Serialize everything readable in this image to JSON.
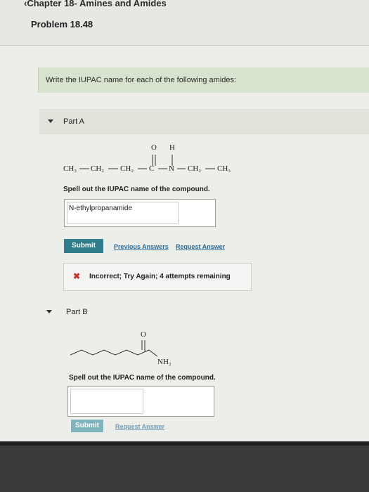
{
  "header": {
    "back_link": "Chapter 18- Amines and Amides",
    "problem_title": "Problem 18.48"
  },
  "instruction": "Write the IUPAC name for each of the following amides:",
  "part_a": {
    "label": "Part A",
    "structure": {
      "ch3_left": "CH₃",
      "ch2_1": "CH₂",
      "ch2_2": "CH₂",
      "c": "C",
      "n": "N",
      "ch2_3": "CH₂",
      "ch3_right": "CH₃",
      "o": "O",
      "h": "H"
    },
    "prompt": "Spell out the IUPAC name of the compound.",
    "answer_value": "N-ethylpropanamide",
    "submit_label": "Submit",
    "previous_answers_label": "Previous Answers",
    "request_answer_label": "Request Answer",
    "feedback": "Incorrect; Try Again; 4 attempts remaining"
  },
  "part_b": {
    "label": "Part B",
    "structure": {
      "o": "O",
      "nh2": "NH₂"
    },
    "prompt": "Spell out the IUPAC name of the compound.",
    "answer_value": "",
    "submit_label": "Submit",
    "request_answer_label": "Request Answer"
  },
  "colors": {
    "instruction_bg": "#d7e3cf",
    "submit_bg": "#2e7d8c",
    "link": "#2a6a9a",
    "error": "#c8302a"
  },
  "icons": {
    "back": "chevron-left-icon",
    "collapse": "triangle-down-icon",
    "incorrect": "x-mark-icon"
  }
}
